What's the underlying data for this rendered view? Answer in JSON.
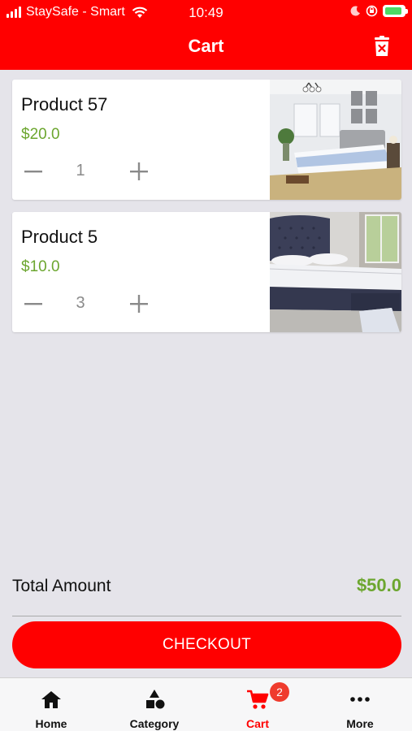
{
  "status_bar": {
    "carrier": "StaySafe - Smart",
    "time": "10:49"
  },
  "header": {
    "title": "Cart",
    "delete_icon": "trash-icon"
  },
  "cart": {
    "items": [
      {
        "name": "Product 57",
        "price": "$20.0",
        "quantity": "1",
        "image": "bedroom-photo"
      },
      {
        "name": "Product 5",
        "price": "$10.0",
        "quantity": "3",
        "image": "bed-photo"
      }
    ],
    "total_label": "Total Amount",
    "total_value": "$50.0",
    "checkout_label": "CHECKOUT"
  },
  "tabs": [
    {
      "label": "Home",
      "icon": "home-icon"
    },
    {
      "label": "Category",
      "icon": "category-icon"
    },
    {
      "label": "Cart",
      "icon": "cart-icon",
      "badge": "2",
      "active": true
    },
    {
      "label": "More",
      "icon": "more-icon"
    }
  ],
  "colors": {
    "brand": "#ff0000",
    "price": "#6ca62f",
    "background": "#e5e4ea",
    "badge": "#ef3b2d"
  }
}
